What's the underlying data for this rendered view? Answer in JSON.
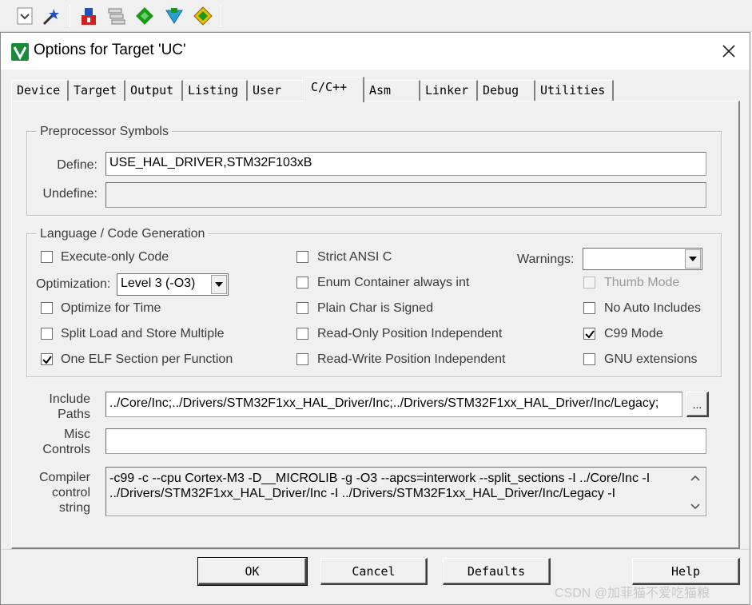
{
  "dialog": {
    "title": "Options for Target 'UC'",
    "close_glyph": "✕"
  },
  "tabs": [
    {
      "label": "Device",
      "active": false
    },
    {
      "label": "Target",
      "active": false
    },
    {
      "label": "Output",
      "active": false
    },
    {
      "label": "Listing",
      "active": false
    },
    {
      "label": "User",
      "active": false
    },
    {
      "label": "C/C++",
      "active": true
    },
    {
      "label": "Asm",
      "active": false
    },
    {
      "label": "Linker",
      "active": false
    },
    {
      "label": "Debug",
      "active": false
    },
    {
      "label": "Utilities",
      "active": false
    }
  ],
  "preprocessor": {
    "group_label": "Preprocessor Symbols",
    "define_label": "Define:",
    "define_value": "USE_HAL_DRIVER,STM32F103xB",
    "undefine_label": "Undefine:",
    "undefine_value": ""
  },
  "codegen": {
    "group_label": "Language / Code Generation",
    "optimization_label": "Optimization:",
    "optimization_value": "Level 3 (-O3)",
    "warnings_label": "Warnings:",
    "warnings_value": "",
    "checkboxes": {
      "execute_only": {
        "label": "Execute-only Code",
        "checked": false
      },
      "optimize_time": {
        "label": "Optimize for Time",
        "checked": false
      },
      "split_load": {
        "label": "Split Load and Store Multiple",
        "checked": false
      },
      "one_elf": {
        "label": "One ELF Section per Function",
        "checked": true
      },
      "strict_ansi": {
        "label": "Strict ANSI C",
        "checked": false
      },
      "enum_container": {
        "label": "Enum Container always int",
        "checked": false
      },
      "plain_char": {
        "label": "Plain Char is Signed",
        "checked": false
      },
      "ro_pos": {
        "label": "Read-Only Position Independent",
        "checked": false
      },
      "rw_pos": {
        "label": "Read-Write Position Independent",
        "checked": false
      },
      "thumb_mode": {
        "label": "Thumb Mode",
        "checked": false,
        "disabled": true
      },
      "no_auto_includes": {
        "label": "No Auto Includes",
        "checked": false
      },
      "c99_mode": {
        "label": "C99 Mode",
        "checked": true
      },
      "gnu_ext": {
        "label": "GNU extensions",
        "checked": false
      }
    }
  },
  "include_paths": {
    "label_line1": "Include",
    "label_line2": "Paths",
    "value": "../Core/Inc;../Drivers/STM32F1xx_HAL_Driver/Inc;../Drivers/STM32F1xx_HAL_Driver/Inc/Legacy;",
    "browse_label": "..."
  },
  "misc_controls": {
    "label_line1": "Misc",
    "label_line2": "Controls",
    "value": ""
  },
  "compiler_string": {
    "label_line1": "Compiler",
    "label_line2": "control",
    "label_line3": "string",
    "line1": "-c99 -c --cpu Cortex-M3 -D__MICROLIB -g -O3 --apcs=interwork --split_sections -I ../Core/Inc -I",
    "line2": "../Drivers/STM32F1xx_HAL_Driver/Inc -I ../Drivers/STM32F1xx_HAL_Driver/Inc/Legacy -I"
  },
  "buttons": {
    "ok": "OK",
    "cancel": "Cancel",
    "defaults": "Defaults",
    "help": "Help"
  },
  "watermark": "CSDN @加菲猫不爱吃猫粮",
  "colors": {
    "dialog_bg": "#f0f0f0",
    "field_bg": "#ffffff",
    "icon_red": "#d02020",
    "icon_green": "#1a9a1a",
    "icon_blue": "#2050c0"
  },
  "icons": [
    "options-wand-icon",
    "load-icon",
    "stack-icon",
    "diamond-icon",
    "download-icon",
    "flash-icon"
  ]
}
